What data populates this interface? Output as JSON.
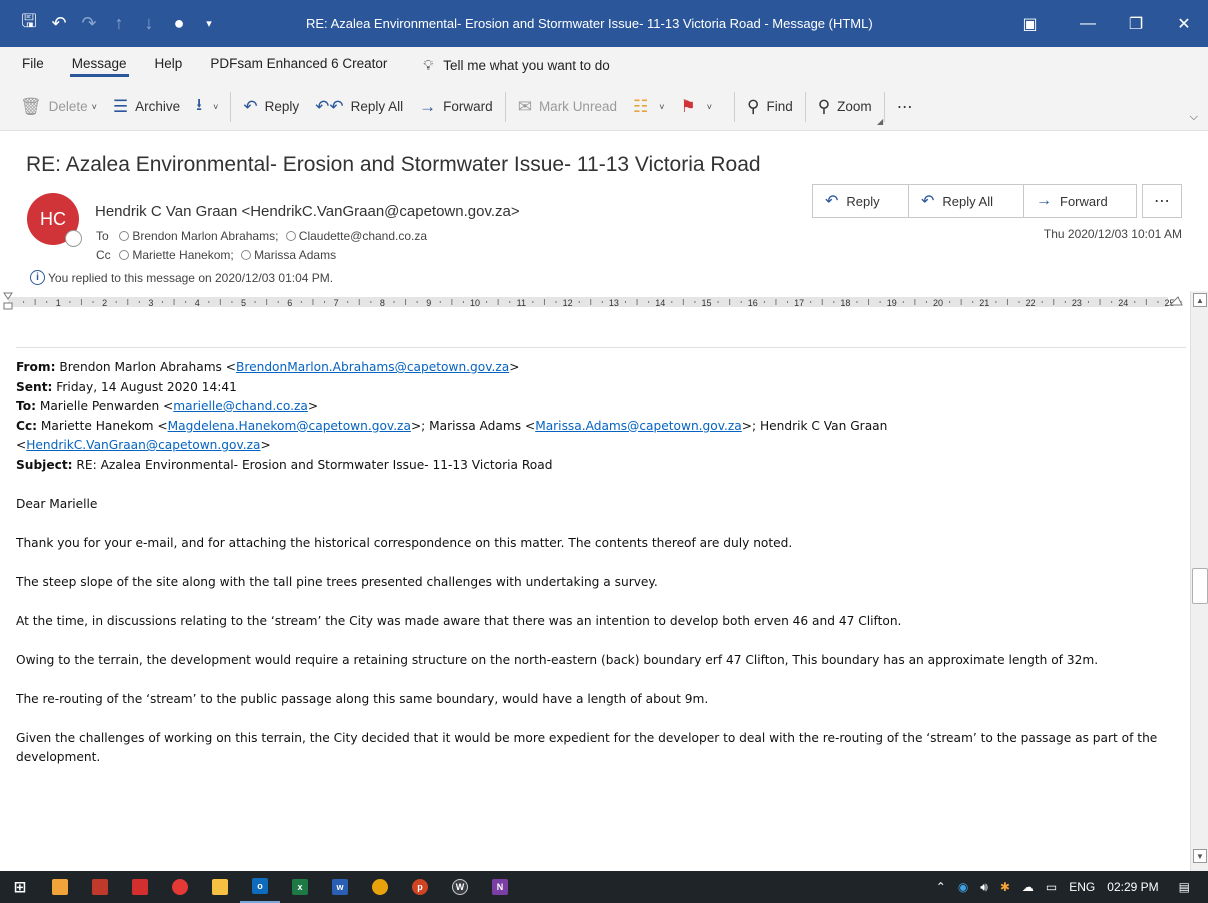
{
  "window": {
    "title": "RE: Azalea Environmental- Erosion and Stormwater Issue- 11-13 Victoria Road  -  Message (HTML)"
  },
  "menu": {
    "tabs": [
      "File",
      "Message",
      "Help",
      "PDFsam Enhanced 6 Creator"
    ],
    "active": "Message",
    "tell_me": "Tell me what you want to do"
  },
  "ribbon": {
    "delete": "Delete",
    "archive": "Archive",
    "reply": "Reply",
    "reply_all": "Reply All",
    "forward": "Forward",
    "mark_unread": "Mark Unread",
    "find": "Find",
    "zoom": "Zoom"
  },
  "header": {
    "subject": "RE: Azalea Environmental- Erosion and Stormwater Issue- 11-13 Victoria Road",
    "avatar_initials": "HC",
    "sender": "Hendrik C Van Graan <HendrikC.VanGraan@capetown.gov.za>",
    "to_label": "To",
    "to": [
      "Brendon Marlon Abrahams;",
      "Claudette@chand.co.za"
    ],
    "cc_label": "Cc",
    "cc": [
      "Mariette Hanekom;",
      "Marissa Adams"
    ],
    "replied_note": "You replied to this message on 2020/12/03 01:04 PM.",
    "datetime": "Thu 2020/12/03 10:01 AM",
    "actions": {
      "reply": "Reply",
      "reply_all": "Reply All",
      "forward": "Forward"
    }
  },
  "ruler": {
    "numbers": [
      "1",
      "2",
      "3",
      "4",
      "5",
      "6",
      "7",
      "8",
      "9",
      "10",
      "11",
      "12",
      "13",
      "14",
      "15",
      "16",
      "17",
      "18",
      "19",
      "20",
      "21",
      "22",
      "23",
      "24",
      "25"
    ]
  },
  "body": {
    "from_label": "From:",
    "from_name": " Brendon Marlon Abrahams <",
    "from_email": "BrendonMarlon.Abrahams@capetown.gov.za",
    "sent_label": "Sent:",
    "sent": " Friday, 14 August 2020 14:41",
    "to_label": "To:",
    "to_name": " Marielle Penwarden <",
    "to_email": "marielle@chand.co.za",
    "cc_label": "Cc:",
    "cc_name1": " Mariette Hanekom <",
    "cc_email1": "Magdelena.Hanekom@capetown.gov.za",
    "cc_name2": ">; Marissa Adams <",
    "cc_email2": "Marissa.Adams@capetown.gov.za",
    "cc_name3": ">; Hendrik C Van Graan",
    "cc_email3": "HendrikC.VanGraan@capetown.gov.za",
    "subject_label": "Subject:",
    "subject": " RE: Azalea Environmental- Erosion and Stormwater Issue- 11-13 Victoria Road",
    "greeting": "Dear Marielle",
    "paragraphs": [
      "Thank you for your e-mail, and for attaching the historical correspondence on this matter. The contents thereof are duly noted.",
      "The steep slope of the site along with the tall pine trees presented challenges with undertaking a  survey.",
      "At the time, in discussions relating to the ‘stream’ the City was made aware that there was an intention to develop both erven 46 and 47 Clifton.",
      "Owing to the terrain, the development would require a retaining structure on the north-eastern (back) boundary erf 47 Clifton, This boundary has an approximate length of 32m.",
      "The re-routing of the ‘stream’ to the public passage along this same boundary, would have a length of about 9m.",
      "Given the challenges of working on this terrain, the City decided that it would be more expedient for the developer to deal with the re-routing  of the ‘stream’ to the passage as part of the development."
    ]
  },
  "taskbar": {
    "language": "ENG",
    "time": "02:29 PM"
  },
  "colors": {
    "title_bar": "#2b579a",
    "avatar": "#d13438",
    "link": "#0563c1",
    "taskbar": "#1e2428"
  }
}
